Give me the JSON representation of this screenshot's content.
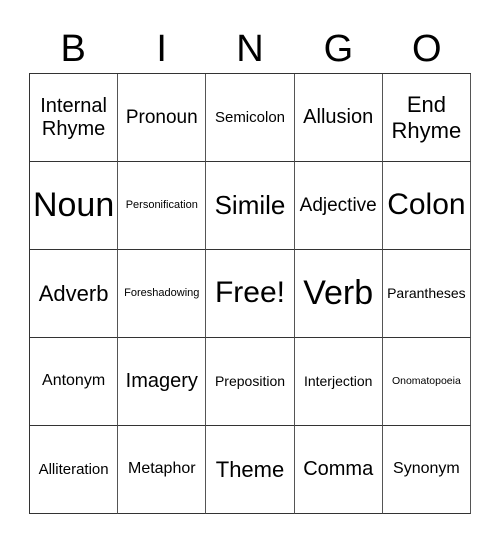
{
  "header": [
    "B",
    "I",
    "N",
    "G",
    "O"
  ],
  "cells": [
    [
      "Internal Rhyme",
      "Pronoun",
      "Semicolon",
      "Allusion",
      "End Rhyme"
    ],
    [
      "Noun",
      "Personification",
      "Simile",
      "Adjective",
      "Colon"
    ],
    [
      "Adverb",
      "Foreshadowing",
      "Free!",
      "Verb",
      "Parantheses"
    ],
    [
      "Antonym",
      "Imagery",
      "Preposition",
      "Interjection",
      "Onomatopoeia"
    ],
    [
      "Alliteration",
      "Metaphor",
      "Theme",
      "Comma",
      "Synonym"
    ]
  ]
}
